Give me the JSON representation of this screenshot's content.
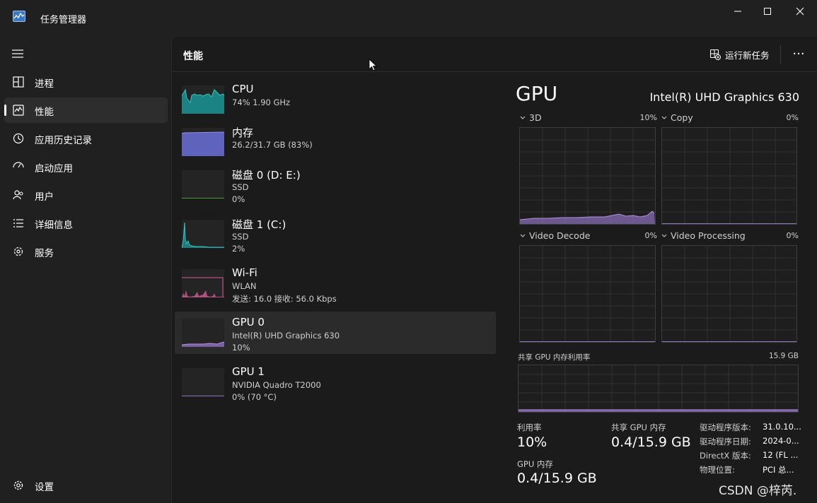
{
  "window": {
    "title": "任务管理器"
  },
  "sidebar": {
    "items": [
      {
        "label": "进程",
        "icon": "processes-icon"
      },
      {
        "label": "性能",
        "icon": "performance-icon",
        "active": true
      },
      {
        "label": "应用历史记录",
        "icon": "history-icon"
      },
      {
        "label": "启动应用",
        "icon": "startup-icon"
      },
      {
        "label": "用户",
        "icon": "users-icon"
      },
      {
        "label": "详细信息",
        "icon": "details-icon"
      },
      {
        "label": "服务",
        "icon": "services-icon"
      }
    ],
    "settings_label": "设置"
  },
  "header": {
    "title": "性能",
    "run_task": "运行新任务",
    "more": "···"
  },
  "devices": [
    {
      "name": "CPU",
      "line1": "74%  1.90 GHz",
      "line2": "",
      "color": "#1aa3a3"
    },
    {
      "name": "内存",
      "line1": "26.2/31.7 GB (83%)",
      "line2": "",
      "color": "#6b6fd6"
    },
    {
      "name": "磁盘 0 (D: E:)",
      "line1": "SSD",
      "line2": "0%",
      "color": "#4a9b3a"
    },
    {
      "name": "磁盘 1 (C:)",
      "line1": "SSD",
      "line2": "2%",
      "color": "#1aa3a3"
    },
    {
      "name": "Wi-Fi",
      "line1": "WLAN",
      "line2": "发送: 16.0  接收: 56.0 Kbps",
      "color": "#d45a9a"
    },
    {
      "name": "GPU 0",
      "line1": "Intel(R) UHD Graphics 630",
      "line2": "10%",
      "color": "#9070c0",
      "active": true
    },
    {
      "name": "GPU 1",
      "line1": "NVIDIA Quadro T2000",
      "line2": "0% (70 °C)",
      "color": "#9070c0"
    }
  ],
  "detail": {
    "title": "GPU",
    "model": "Intel(R) UHD Graphics 630",
    "engines": [
      {
        "label": "3D",
        "pct": "10%"
      },
      {
        "label": "Copy",
        "pct": "0%"
      },
      {
        "label": "Video Decode",
        "pct": "0%"
      },
      {
        "label": "Video Processing",
        "pct": "0%"
      }
    ],
    "shared_mem_label": "共享 GPU 内存利用率",
    "shared_mem_max": "15.9 GB",
    "stats": {
      "util_label": "利用率",
      "util_value": "10%",
      "shared_label": "共享 GPU 内存",
      "shared_value": "0.4/15.9 GB",
      "gpumem_label": "GPU 内存",
      "gpumem_value": "0.4/15.9 GB"
    },
    "info": [
      {
        "key": "驱动程序版本:",
        "val": "31.0.10..."
      },
      {
        "key": "驱动程序日期:",
        "val": "2024-0..."
      },
      {
        "key": "DirectX 版本:",
        "val": "12 (FL ..."
      },
      {
        "key": "物理位置:",
        "val": "PCI 总..."
      }
    ]
  },
  "watermark": "CSDN @梓芮."
}
